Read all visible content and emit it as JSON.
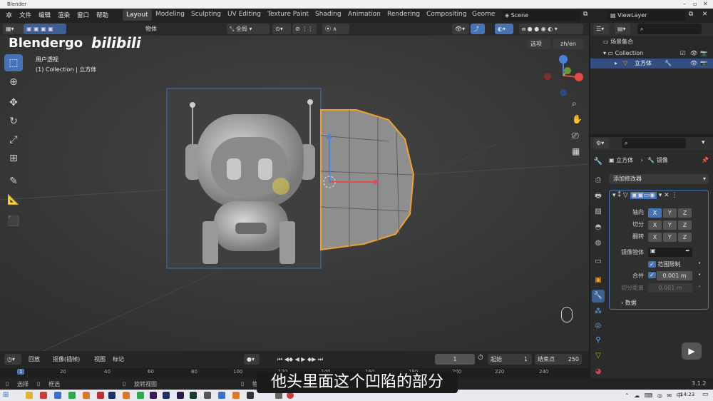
{
  "window": {
    "title": "Blender"
  },
  "watermark": {
    "left": "Blendergo",
    "right": "bilibili"
  },
  "menu": [
    "文件",
    "编辑",
    "渲染",
    "窗口",
    "帮助"
  ],
  "workspaces": [
    "Layout",
    "Modeling",
    "Sculpting",
    "UV Editing",
    "Texture Paint",
    "Shading",
    "Animation",
    "Rendering",
    "Compositing",
    "Geometr"
  ],
  "scene": {
    "name": "Scene",
    "view_layer": "ViewLayer"
  },
  "viewport_header": {
    "object_menu": "物体",
    "orientation": "全局",
    "select_btn": "选项",
    "lang": "zh/en"
  },
  "viewport": {
    "view_name": "用户透视",
    "collection_info": "(1) Collection | 立方体"
  },
  "outliner": {
    "root": "场景集合",
    "collection": "Collection",
    "object": "立方体"
  },
  "properties": {
    "breadcrumb_obj": "立方体",
    "breadcrumb_mod": "镜像",
    "add_modifier": "添加修改器",
    "axis_label": "轴向",
    "bisect_label": "切分",
    "flip_label": "翻转",
    "axes": [
      "X",
      "Y",
      "Z"
    ],
    "mirror_obj_label": "镜像物体",
    "clip_label": "范围限制",
    "merge_label": "合并",
    "merge_value": "0.001 m",
    "bisect_dist_label": "切分距离",
    "bisect_dist_value": "0.001 m",
    "data_label": "数据"
  },
  "timeline": {
    "playback": "回放",
    "keying": "抠像(插帧)",
    "view": "视图",
    "marker": "标记",
    "current_frame": "1",
    "start_label": "起始",
    "start": "1",
    "end_label": "结束点",
    "end": "250",
    "ticks": [
      "1",
      "20",
      "40",
      "60",
      "80",
      "100",
      "120",
      "140",
      "160",
      "180",
      "200",
      "220",
      "240"
    ]
  },
  "status": {
    "select": "选择",
    "box": "框选",
    "rotate": "旋转视图",
    "object": "物体",
    "version": "3.1.2"
  },
  "taskbar": {
    "time": "14:23"
  },
  "subtitle": "他头里面这个凹陷的部分"
}
